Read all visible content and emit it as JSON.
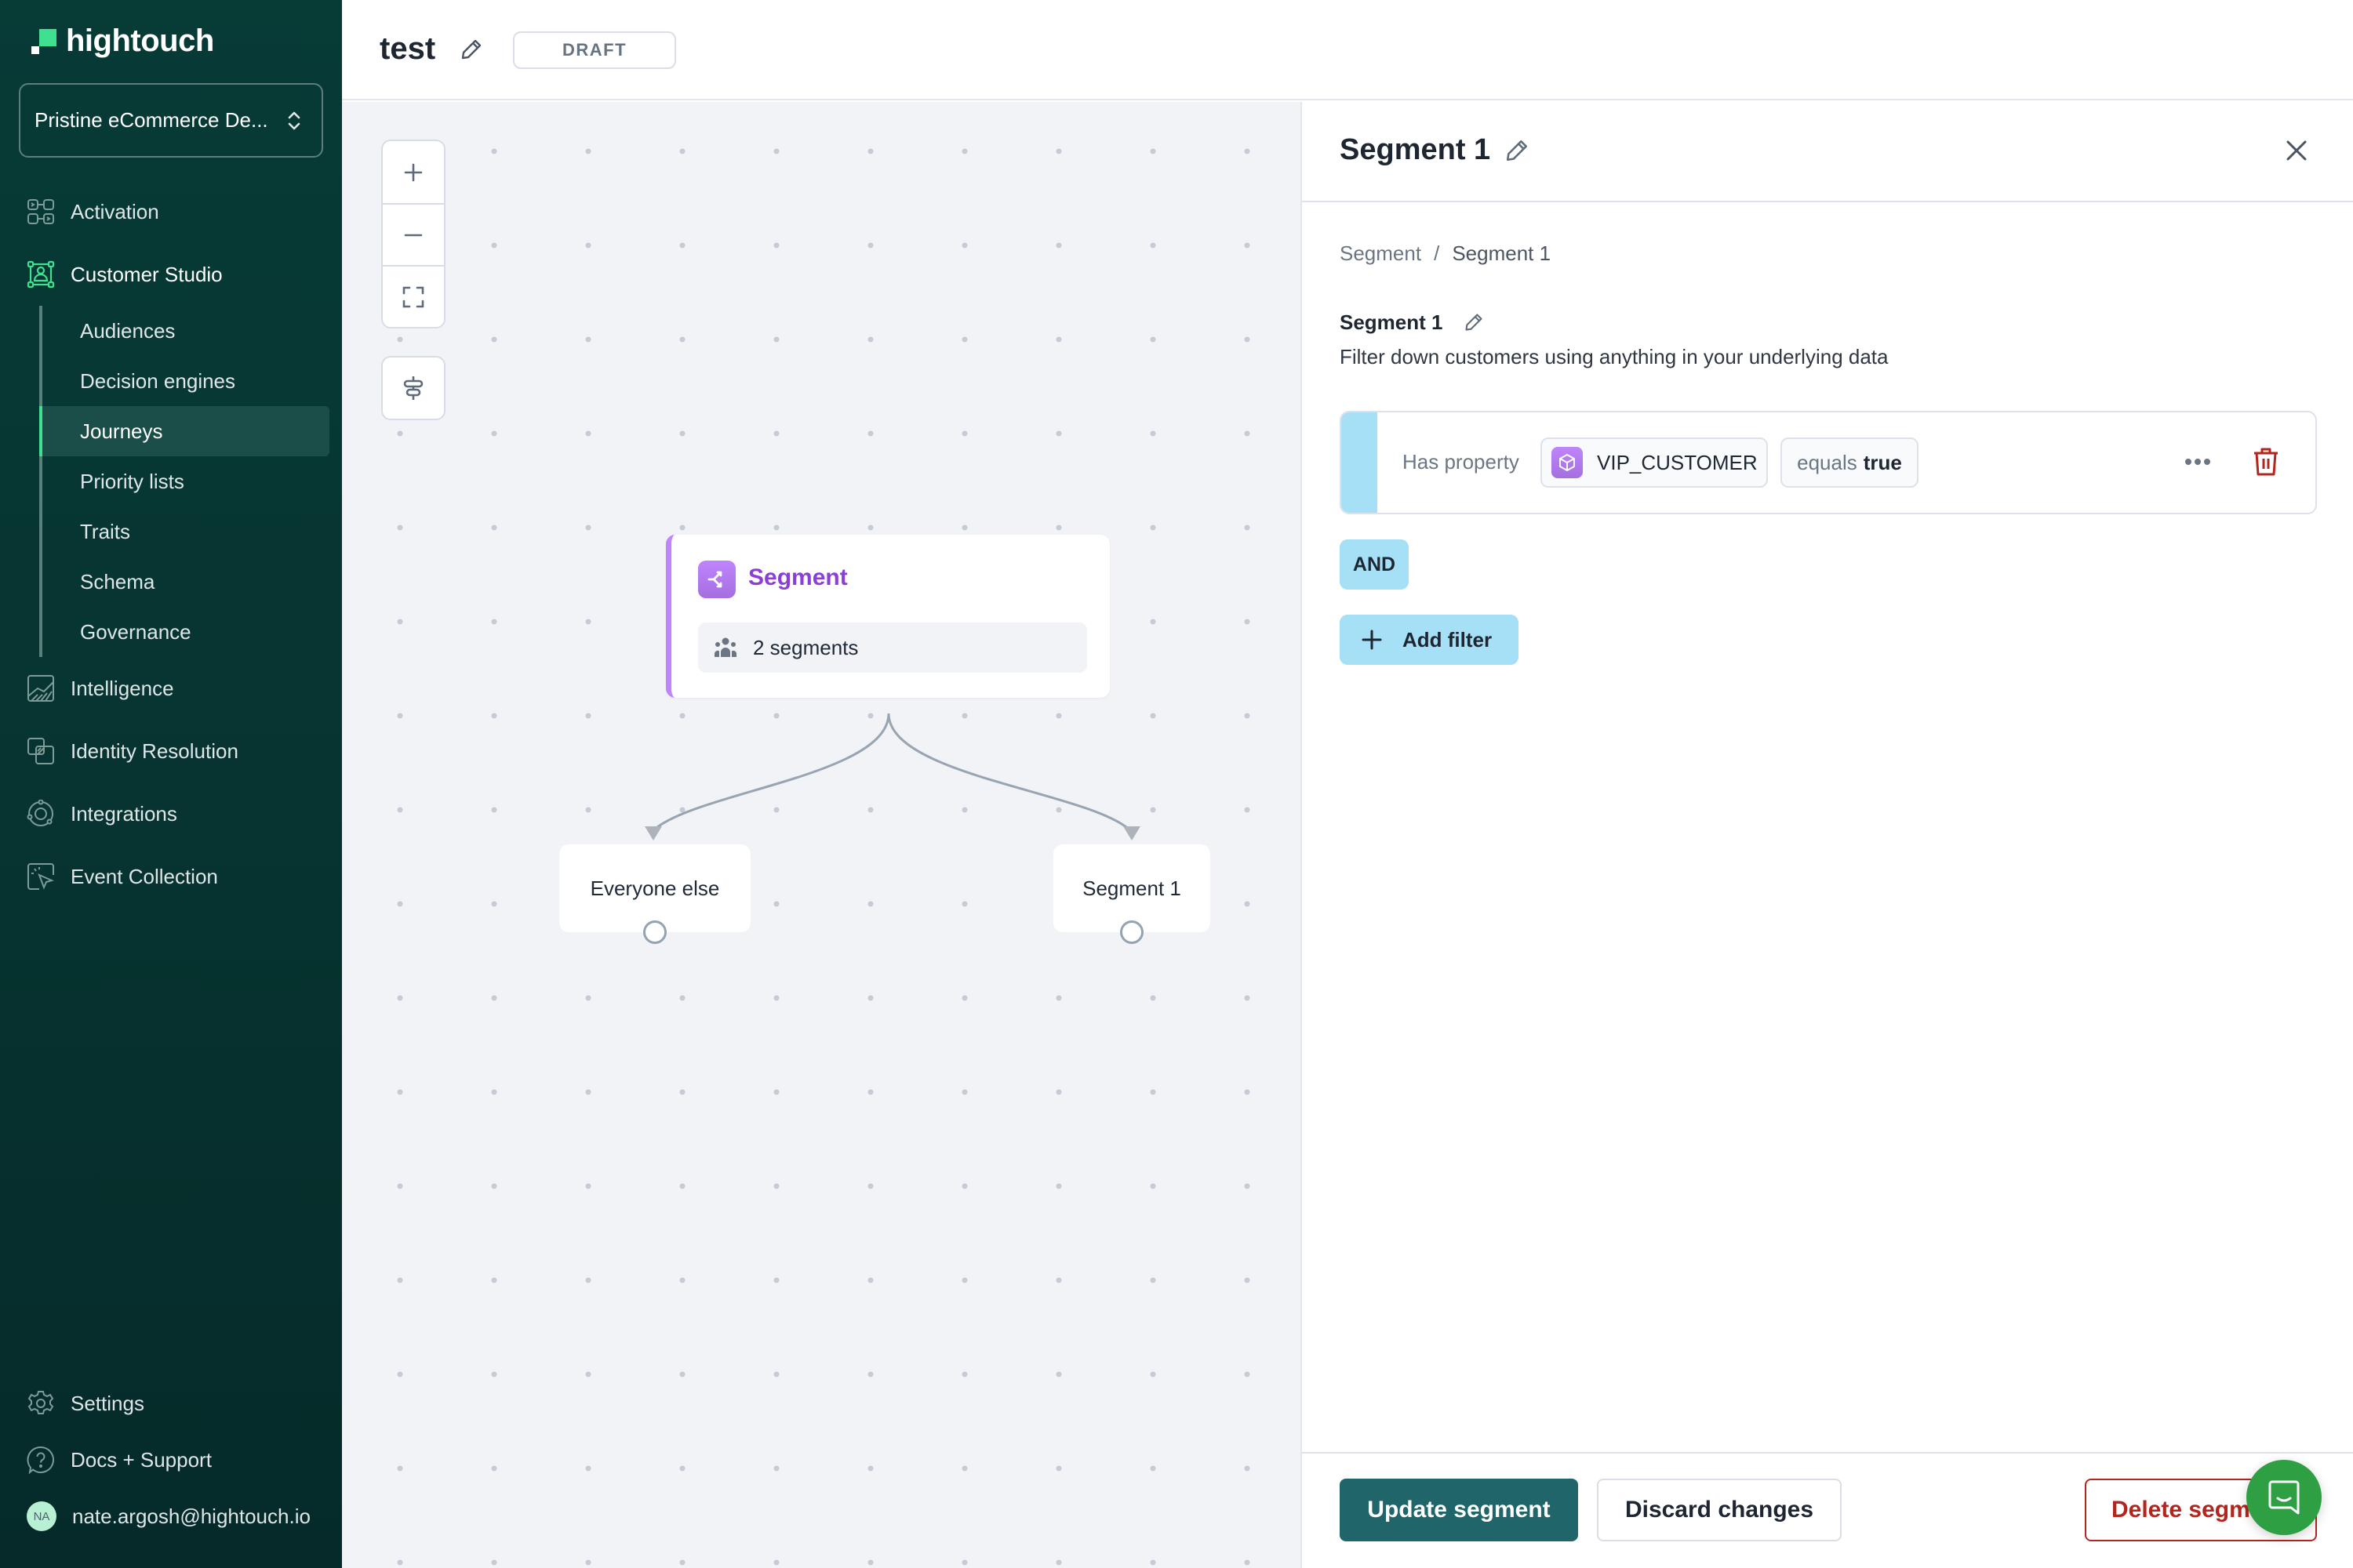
{
  "app": {
    "brand": "hightouch"
  },
  "sidebar": {
    "workspace": "Pristine eCommerce De...",
    "items": [
      {
        "label": "Activation",
        "icon": "activation-icon"
      },
      {
        "label": "Customer Studio",
        "icon": "customer-studio-icon",
        "active": true,
        "children": [
          {
            "label": "Audiences"
          },
          {
            "label": "Decision engines"
          },
          {
            "label": "Journeys",
            "active": true
          },
          {
            "label": "Priority lists"
          },
          {
            "label": "Traits"
          },
          {
            "label": "Schema"
          },
          {
            "label": "Governance"
          }
        ]
      },
      {
        "label": "Intelligence",
        "icon": "intelligence-icon"
      },
      {
        "label": "Identity Resolution",
        "icon": "identity-resolution-icon"
      },
      {
        "label": "Integrations",
        "icon": "integrations-icon"
      },
      {
        "label": "Event Collection",
        "icon": "event-collection-icon"
      }
    ],
    "bottom": [
      {
        "label": "Settings",
        "icon": "gear-icon"
      },
      {
        "label": "Docs + Support",
        "icon": "help-icon"
      }
    ],
    "user": {
      "initials": "NA",
      "email": "nate.argosh@hightouch.io"
    }
  },
  "header": {
    "title": "test",
    "status": "DRAFT"
  },
  "canvas": {
    "controls": {
      "zoom_in": "+",
      "zoom_out": "−"
    },
    "segment_node": {
      "title": "Segment",
      "count_label": "2 segments"
    },
    "branches": [
      {
        "label": "Everyone else"
      },
      {
        "label": "Segment 1"
      }
    ]
  },
  "panel": {
    "title": "Segment 1",
    "breadcrumb": [
      "Segment",
      "Segment 1"
    ],
    "breadcrumb_separator": "/",
    "segment_name": "Segment 1",
    "description": "Filter down customers using anything in your underlying data",
    "filter": {
      "prefix": "Has property",
      "property": "VIP_CUSTOMER",
      "operator": "equals",
      "value": "true"
    },
    "conjunction": "AND",
    "add_filter_label": "Add filter",
    "footer": {
      "update_label": "Update segment",
      "discard_label": "Discard changes",
      "delete_label": "Delete segment"
    }
  },
  "colors": {
    "accent_primary": "#1f6569",
    "segment_purple": "#8b3fd6",
    "filter_blue": "#a6e0f7",
    "danger": "#b3261e",
    "chat_green": "#2ea043"
  }
}
